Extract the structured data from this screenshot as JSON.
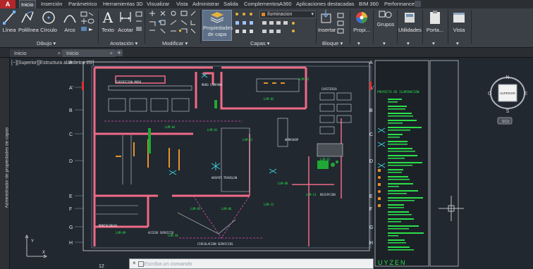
{
  "app": {
    "button": "A"
  },
  "menu_tabs": [
    "Inicio",
    "Inserción",
    "Parámetrico",
    "Herramientas 3D",
    "Visualizar",
    "Vista",
    "Administrar",
    "Salida",
    "Complementos",
    "A360",
    "Aplicaciones destacadas",
    "BIM 360",
    "Performance"
  ],
  "ribbon": {
    "draw": {
      "line": "Línea",
      "polyline": "Polilínea",
      "circle": "Círculo",
      "arc": "Arco",
      "group": "Dibujo"
    },
    "annotation": {
      "text": "Texto",
      "dimension": "Acotar",
      "group": "Anotación"
    },
    "modify": {
      "group": "Modificar"
    },
    "layers": {
      "properties_line1": "Propiedades",
      "properties_line2": "de capa",
      "current_layer": "Iluminacion",
      "group": "Capas"
    },
    "block": {
      "insert": "Insertar",
      "group": "Bloque"
    },
    "properties": {
      "label": "Propi..."
    },
    "groups": {
      "label": "Grupos"
    },
    "utilities": {
      "label": "Utilidades"
    },
    "clipboard": {
      "label": "Porta..."
    },
    "view": {
      "label": "Vista"
    }
  },
  "doc_tabs": [
    "Inicio",
    "Inicio"
  ],
  "side_panel": {
    "label": "Administrador de propiedades de capas"
  },
  "viewport": {
    "label": "[−][Superior][Estructura alámbrica 2D]"
  },
  "viewcube": {
    "label": "SUPERIOR",
    "n": "N",
    "s": "S",
    "e": "E",
    "w": "O",
    "ucs": "SCU"
  },
  "command_line": {
    "placeholder": "Escriba un comando"
  },
  "drawing": {
    "grid_rows": [
      "A",
      "A'",
      "B",
      "C",
      "D",
      "E",
      "F",
      "G",
      "H"
    ],
    "col_bottom": "12",
    "rooms": [
      "EXHIBICION MURO",
      "MURO CAMPAÑA",
      "CAFETERIA",
      "WORKSHOP",
      "HOSPOT TRAVELON",
      "RECEPCION",
      "CIRCULACION SERVICIOS",
      "MONTACARGAS",
      "ACCESO SERVICIO"
    ],
    "legend_title": "PROYECTO DE ILUMINACION",
    "footer_brand": "UYZEN"
  },
  "colors": {
    "accent_red": "#b4262a",
    "wall": "#f06a86",
    "cad_green": "#2be04a",
    "drawing_bg": "#212830",
    "ribbon_bg": "#3b3f46"
  }
}
